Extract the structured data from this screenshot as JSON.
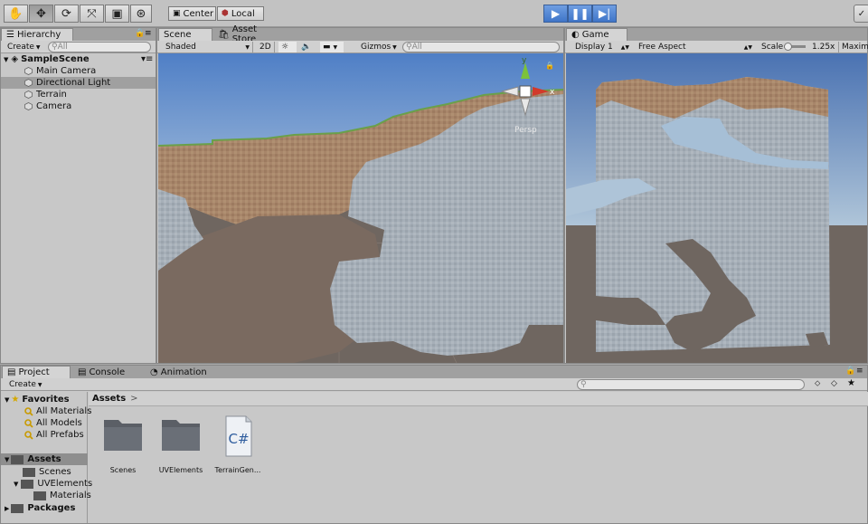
{
  "toolbar": {
    "pivot_label": "Center",
    "space_label": "Local",
    "tools": [
      "hand-tool",
      "move-tool",
      "rotate-tool",
      "scale-tool",
      "rect-tool",
      "transform-tool"
    ]
  },
  "hierarchy": {
    "tab_label": "Hierarchy",
    "create_label": "Create",
    "search_placeholder": "All",
    "scene_name": "SampleScene",
    "items": [
      {
        "label": "Main Camera"
      },
      {
        "label": "Directional Light",
        "selected": true
      },
      {
        "label": "Terrain"
      },
      {
        "label": "Camera"
      }
    ]
  },
  "scene": {
    "tab_label": "Scene",
    "asset_store_label": "Asset Store",
    "shading_mode": "Shaded",
    "mode_2d": "2D",
    "gizmos_label": "Gizmos",
    "search_placeholder": "All",
    "persp_label": "Persp",
    "gizmo_axes": {
      "y": "y",
      "x": "x"
    }
  },
  "game": {
    "tab_label": "Game",
    "display": "Display 1",
    "aspect": "Free Aspect",
    "scale_label": "Scale",
    "scale_value": "1.25x",
    "maximize_label": "Maximiz"
  },
  "project": {
    "tab_project": "Project",
    "tab_console": "Console",
    "tab_animation": "Animation",
    "create_label": "Create",
    "favorites_label": "Favorites",
    "favorites": [
      "All Materials",
      "All Models",
      "All Prefabs"
    ],
    "assets_label": "Assets",
    "asset_tree": [
      {
        "label": "Scenes",
        "depth": 1
      },
      {
        "label": "UVElements",
        "depth": 1
      },
      {
        "label": "Materials",
        "depth": 2
      }
    ],
    "packages_label": "Packages",
    "breadcrumb": "Assets",
    "breadcrumb_sep": ">",
    "assets": [
      {
        "name": "Scenes",
        "type": "folder"
      },
      {
        "name": "UVElements",
        "type": "folder"
      },
      {
        "name": "TerrainGen...",
        "type": "script",
        "glyph": "C#"
      }
    ]
  },
  "colors": {
    "sky": "#8cb4dd",
    "dirt": "#a8866a",
    "stone": "#a6afb8",
    "ground": "#7a6a60",
    "play_blue": "#4d86d8"
  }
}
